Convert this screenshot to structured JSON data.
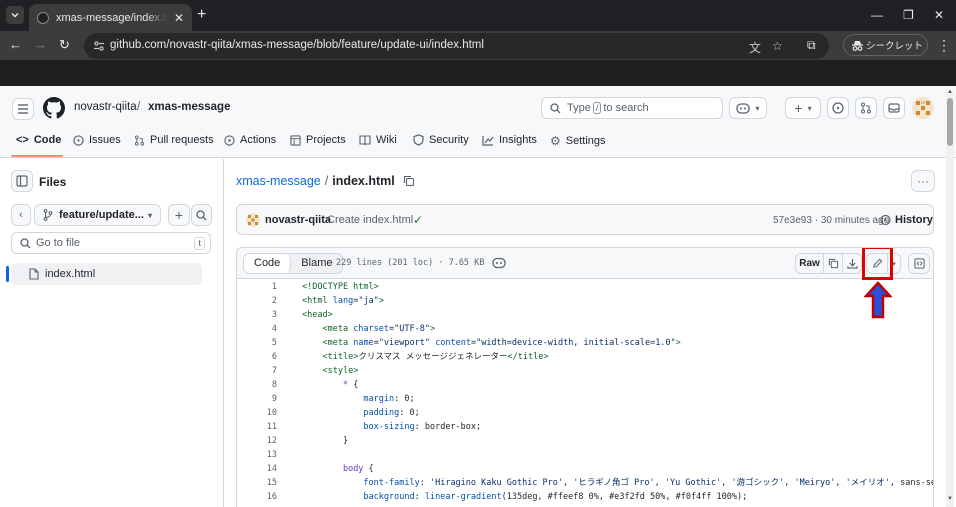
{
  "browser": {
    "tab_title": "xmas-message/index.html at",
    "url": "github.com/novastr-qiita/xmas-message/blob/feature/update-ui/index.html",
    "incognito_label": "シークレット"
  },
  "header": {
    "owner": "novastr-qiita",
    "separator": "/",
    "repo": "xmas-message",
    "search_prefix": "Type",
    "search_key": "/",
    "search_suffix": "to search"
  },
  "repo_nav": {
    "items": [
      {
        "label": "Code",
        "icon": "code-icon"
      },
      {
        "label": "Issues",
        "icon": "issue-icon"
      },
      {
        "label": "Pull requests",
        "icon": "pull-request-icon"
      },
      {
        "label": "Actions",
        "icon": "play-icon"
      },
      {
        "label": "Projects",
        "icon": "table-icon"
      },
      {
        "label": "Wiki",
        "icon": "book-icon"
      },
      {
        "label": "Security",
        "icon": "shield-icon"
      },
      {
        "label": "Insights",
        "icon": "graph-icon"
      },
      {
        "label": "Settings",
        "icon": "gear-icon"
      }
    ]
  },
  "files_panel": {
    "title": "Files",
    "branch": "feature/update...",
    "goto_placeholder": "Go to file",
    "goto_key": "t",
    "files": [
      "index.html"
    ]
  },
  "file_view": {
    "repo_link": "xmas-message",
    "path_sep": "/",
    "filename": "index.html",
    "commit_user": "novastr-qiita",
    "commit_message": "Create index.html",
    "commit_meta": "57e3e93 · 30 minutes ago",
    "history_label": "History",
    "tab_code": "Code",
    "tab_blame": "Blame",
    "code_meta": "229 lines (201 loc) · 7.65 KB",
    "raw_label": "Raw"
  },
  "code_lines": [
    {
      "n": "1",
      "html": "<span class=\"tag\">&lt;!DOCTYPE html&gt;</span>"
    },
    {
      "n": "2",
      "html": "<span class=\"tag\">&lt;html</span> <span class=\"attr\">lang</span>=<span class=\"str\">\"ja\"</span><span class=\"tag\">&gt;</span>"
    },
    {
      "n": "3",
      "html": "<span class=\"tag\">&lt;head&gt;</span>"
    },
    {
      "n": "4",
      "html": "    <span class=\"tag\">&lt;meta</span> <span class=\"attr\">charset</span>=<span class=\"str\">\"UTF-8\"</span><span class=\"tag\">&gt;</span>"
    },
    {
      "n": "5",
      "html": "    <span class=\"tag\">&lt;meta</span> <span class=\"attr\">name</span>=<span class=\"str\">\"viewport\"</span> <span class=\"attr\">content</span>=<span class=\"str\">\"width=device-width, initial-scale=1.0\"</span><span class=\"tag\">&gt;</span>"
    },
    {
      "n": "6",
      "html": "    <span class=\"tag\">&lt;title&gt;</span>クリスマス メッセージジェネレーター<span class=\"tag\">&lt;/title&gt;</span>"
    },
    {
      "n": "7",
      "html": "    <span class=\"tag\">&lt;style&gt;</span>"
    },
    {
      "n": "8",
      "html": "        <span class=\"sel\">*</span> {"
    },
    {
      "n": "9",
      "html": "            <span class=\"prop\">margin</span>: 0;"
    },
    {
      "n": "10",
      "html": "            <span class=\"prop\">padding</span>: 0;"
    },
    {
      "n": "11",
      "html": "            <span class=\"prop\">box-sizing</span>: border-box;"
    },
    {
      "n": "12",
      "html": "        }"
    },
    {
      "n": "13",
      "html": ""
    },
    {
      "n": "14",
      "html": "        <span class=\"sel\">body</span> {"
    },
    {
      "n": "15",
      "html": "            <span class=\"prop\">font-family</span>: <span class=\"str\">'Hiragino Kaku Gothic Pro'</span>, <span class=\"str\">'ヒラギノ角ゴ Pro'</span>, <span class=\"str\">'Yu Gothic'</span>, <span class=\"str\">'游ゴシック'</span>, <span class=\"str\">'Meiryo'</span>, <span class=\"str\">'メイリオ'</span>, sans-serif;"
    },
    {
      "n": "16",
      "html": "            <span class=\"prop\">background</span>: <span class=\"attr\">linear-gradient</span>(135deg, #ffeef8 0%, #e3f2fd 50%, #f0f4ff 100%);"
    }
  ]
}
